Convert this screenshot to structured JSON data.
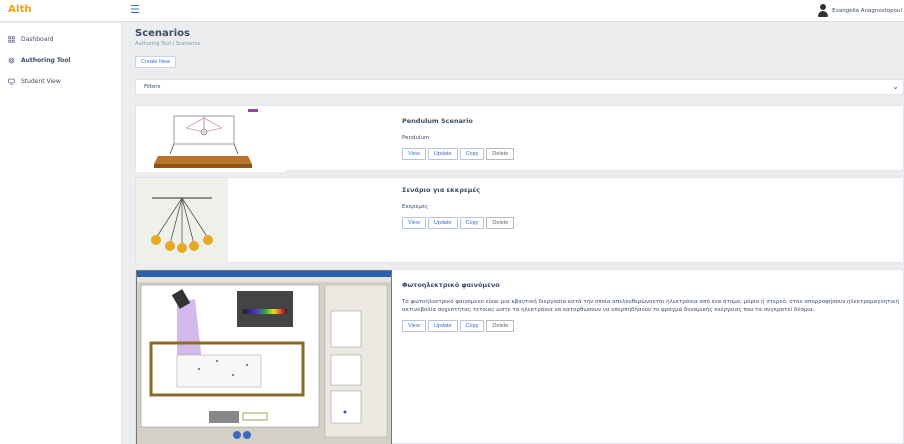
{
  "app": {
    "logo": "Alth"
  },
  "user": {
    "name": "Evangelia Anagnostopoul"
  },
  "sidebar": {
    "items": [
      {
        "label": "Dashboard",
        "icon": "grid-icon"
      },
      {
        "label": "Authoring Tool",
        "icon": "settings-icon"
      },
      {
        "label": "Student View",
        "icon": "monitor-icon"
      }
    ]
  },
  "page": {
    "title": "Scenarios",
    "breadcrumb": "Authoring Tool / Scenarios",
    "create_label": "Create New",
    "filters_label": "Filters"
  },
  "scenarios": [
    {
      "title": "Pendulum Scenario",
      "description": "Pendulum",
      "actions": {
        "view": "View",
        "update": "Update",
        "copy": "Copy",
        "delete": "Delete"
      }
    },
    {
      "title": "Σενάριο για εκκρεμές",
      "description": "Εκκρεμές",
      "actions": {
        "view": "View",
        "update": "Update",
        "copy": "Copy",
        "delete": "Delete"
      }
    },
    {
      "title": "Φωτοηλεκτρικό φαινόμενο",
      "description": "Το φωτοηλεκτρικό φαινόμενο είναι μια κβαντική διεργασία κατά την οποία απελευθερώνονται ηλεκτρόνια από ένα άτομο, μόριο ή στερεό, όταν απορροφήσουν ηλεκτρομαγνητική ακτινοβολία συχνότητας τέτοιας ώστε τα ηλεκτρόνια να κατορθώσουν να υπερπηδήσουν το φράγμα δυναμικής ενέργειας που τα συγκρατεί δέσμια.",
      "actions": {
        "view": "View",
        "update": "Update",
        "copy": "Copy",
        "delete": "Delete"
      }
    }
  ],
  "colors": {
    "accent": "#3a70c9",
    "logo": "#f0a010",
    "background": "#ebedef"
  }
}
